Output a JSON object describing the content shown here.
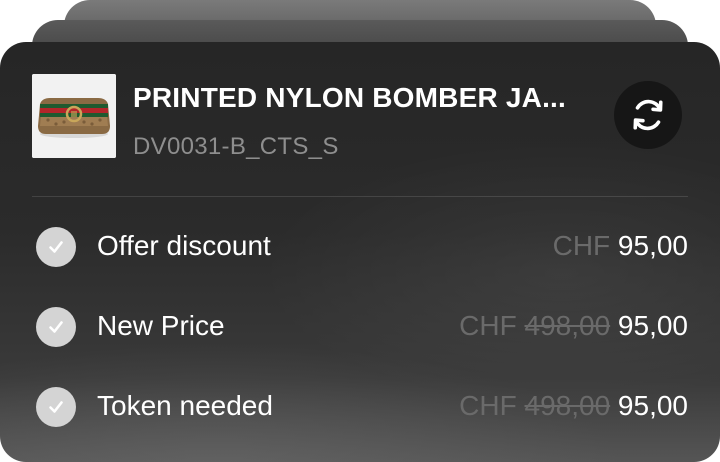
{
  "product": {
    "name": "PRINTED NYLON BOMBER JA...",
    "sku": "DV0031-B_CTS_S",
    "thumbnail_icon": "handbag-thumbnail"
  },
  "actions": {
    "refresh_icon": "refresh-icon"
  },
  "options": [
    {
      "label": "Offer discount",
      "checked": true,
      "currency": "CHF",
      "old_price": "",
      "new_price": "95,00"
    },
    {
      "label": "New Price",
      "checked": true,
      "currency": "CHF",
      "old_price": "498,00",
      "new_price": "95,00"
    },
    {
      "label": "Token needed",
      "checked": true,
      "currency": "CHF",
      "old_price": "498,00",
      "new_price": "95,00"
    }
  ],
  "colors": {
    "card_background": "#262626",
    "text_primary": "#ffffff",
    "text_muted": "#8e8e8e",
    "checkbox": "#d4d4d4"
  }
}
